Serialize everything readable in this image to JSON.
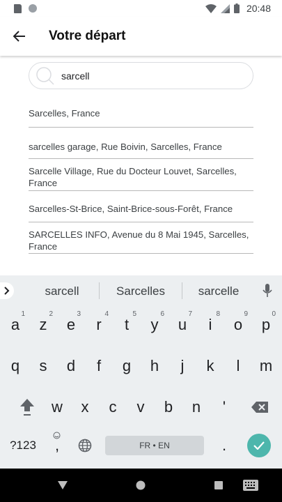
{
  "status_bar": {
    "time": "20:48"
  },
  "header": {
    "title": "Votre départ"
  },
  "search": {
    "value": "sarcell"
  },
  "results": [
    "Sarcelles, France",
    "sarcelles garage, Rue Boivin, Sarcelles, France",
    "Sarcelle Village, Rue du Docteur Louvet, Sarcelles, France",
    "Sarcelles-St-Brice, Saint-Brice-sous-Forêt, France",
    "SARCELLES INFO, Avenue du 8 Mai 1945, Sarcelles, France"
  ],
  "keyboard": {
    "suggestions": [
      "sarcell",
      "Sarcelles",
      "sarcelle"
    ],
    "row1": [
      {
        "k": "a",
        "h": "1"
      },
      {
        "k": "z",
        "h": "2"
      },
      {
        "k": "e",
        "h": "3"
      },
      {
        "k": "r",
        "h": "4"
      },
      {
        "k": "t",
        "h": "5"
      },
      {
        "k": "y",
        "h": "6"
      },
      {
        "k": "u",
        "h": "7"
      },
      {
        "k": "i",
        "h": "8"
      },
      {
        "k": "o",
        "h": "9"
      },
      {
        "k": "p",
        "h": "0"
      }
    ],
    "row2": [
      "q",
      "s",
      "d",
      "f",
      "g",
      "h",
      "j",
      "k",
      "l",
      "m"
    ],
    "row3": [
      "w",
      "x",
      "c",
      "v",
      "b",
      "n",
      "'"
    ],
    "symbols_label": "?123",
    "comma": ",",
    "period": ".",
    "space_label": "FR • EN"
  },
  "colors": {
    "accent": "#4db6ac",
    "keyboard_bg": "#eceff1"
  }
}
